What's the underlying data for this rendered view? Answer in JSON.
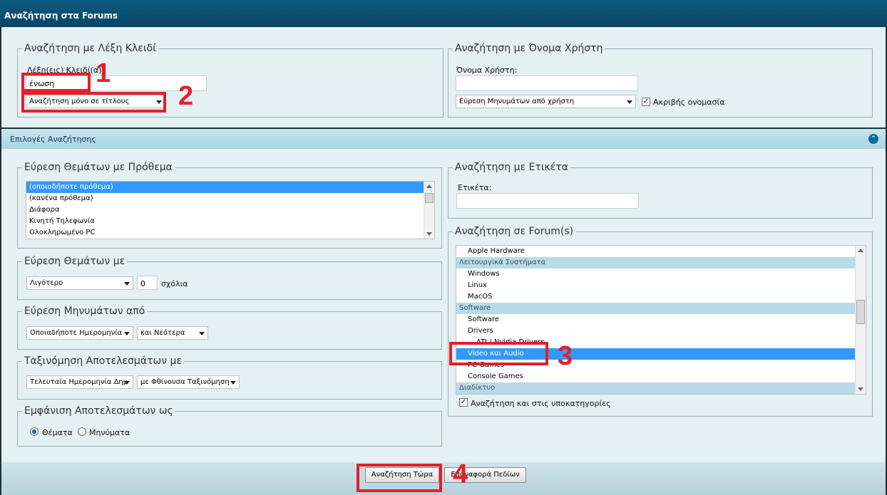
{
  "window": {
    "title": "Αναζήτηση στα Forums"
  },
  "keyword": {
    "legend": "Αναζήτηση με Λέξη Κλειδί",
    "label": "Λέξη(εις) Κλειδί(α):",
    "value": "ένωση",
    "scope": "Αναζήτηση μόνο σε τίτλους"
  },
  "user": {
    "legend": "Αναζήτηση με Όνομα Χρήστη",
    "label": "Όνομα Χρήστη:",
    "value": "",
    "find": "Εύρεση Μηνυμάτων από χρήστη",
    "exact": "Ακριβής ονομασία"
  },
  "options_bar": {
    "label": "Επιλογές Αναζήτησης"
  },
  "prefix": {
    "legend": "Εύρεση Θεμάτων με Πρόθεμα",
    "items": [
      "(οποιοδήποτε πρόθεμα)",
      "(κανένα πρόθεμα)",
      "Διάφορα",
      "Κινητή Τηλεφωνία",
      "Ολοκληρωμένο PC"
    ]
  },
  "replies": {
    "legend": "Εύρεση Θεμάτων με",
    "mode": "Λιγότερο",
    "count": "0",
    "unit": "σχόλια"
  },
  "date": {
    "legend": "Εύρεση Μηνυμάτων από",
    "when": "Οποιαδήποτε Ημερομηνία",
    "direction": "και Νεότερα"
  },
  "sort": {
    "legend": "Ταξινόμηση Αποτελεσμάτων με",
    "by": "Τελευταία Ημερομηνία Δημ",
    "order": "με Φθίνουσα Ταξινόμηση"
  },
  "display": {
    "legend": "Εμφάνιση Αποτελεσμάτων ως",
    "threads": "Θέματα",
    "posts": "Μηνύματα"
  },
  "tag": {
    "legend": "Αναζήτηση με Ετικέτα",
    "label": "Ετικέτα:",
    "value": ""
  },
  "forums": {
    "legend": "Αναζήτηση σε Forum(s)",
    "items": [
      {
        "text": "Apple Hardware",
        "kind": "child"
      },
      {
        "text": "Λειτουργικά Συστήματα",
        "kind": "grp"
      },
      {
        "text": "Windows",
        "kind": "child"
      },
      {
        "text": "Linux",
        "kind": "child"
      },
      {
        "text": "MacOS",
        "kind": "child"
      },
      {
        "text": "Software",
        "kind": "grp"
      },
      {
        "text": "Software",
        "kind": "child"
      },
      {
        "text": "Drivers",
        "kind": "child"
      },
      {
        "text": "ATI / Nvidia Drivers",
        "kind": "child2"
      },
      {
        "text": "Video και Audio",
        "kind": "sel"
      },
      {
        "text": "PC Games",
        "kind": "child"
      },
      {
        "text": "Console Games",
        "kind": "child"
      },
      {
        "text": "Διαδίκτυο",
        "kind": "grp"
      }
    ],
    "subcats": "Αναζήτηση και στις υποκατηγορίες"
  },
  "buttons": {
    "search": "Αναζήτηση Τώρα",
    "reset": "Επαναφορά Πεδίων"
  },
  "annotations": {
    "m1": "1",
    "m2": "2",
    "m3": "3",
    "m4": "4"
  },
  "colors": {
    "accent": "#0f5b82",
    "highlight": "#e2202a",
    "selection": "#3399ff"
  }
}
